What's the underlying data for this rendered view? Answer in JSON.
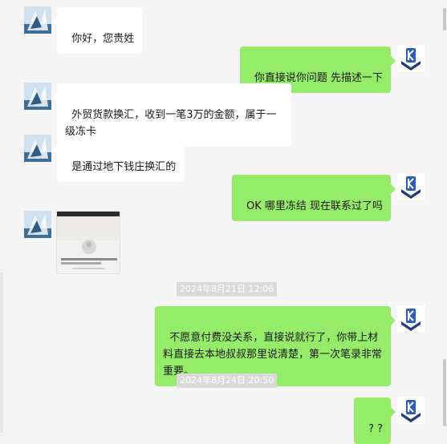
{
  "colors": {
    "background": "#f5f5f5",
    "incoming_bubble": "#ffffff",
    "outgoing_bubble": "#95ec69",
    "timestamp_bg": "#dadada"
  },
  "messages": [
    {
      "direction": "incoming",
      "text": "你好，您贵姓"
    },
    {
      "direction": "outgoing",
      "text": "你直接说你问题 先描述一下"
    },
    {
      "direction": "incoming",
      "text": "外贸货款换汇，收到一笔3万的金额，属于一级冻卡"
    },
    {
      "direction": "incoming",
      "text": "是通过地下钱庄换汇的"
    },
    {
      "direction": "outgoing",
      "text": "OK 哪里冻结 现在联系过了吗"
    },
    {
      "direction": "incoming",
      "type": "image"
    },
    {
      "direction": "outgoing",
      "text": "不愿意付费没关系，直接说就行了，你带上材料直接去本地叔叔那里说清楚，第一次笔录非常重要。"
    },
    {
      "direction": "outgoing",
      "text": "? ?"
    }
  ],
  "timestamps": [
    "2024年8月21日 12:06",
    "2024年8月24日 20:50"
  ]
}
